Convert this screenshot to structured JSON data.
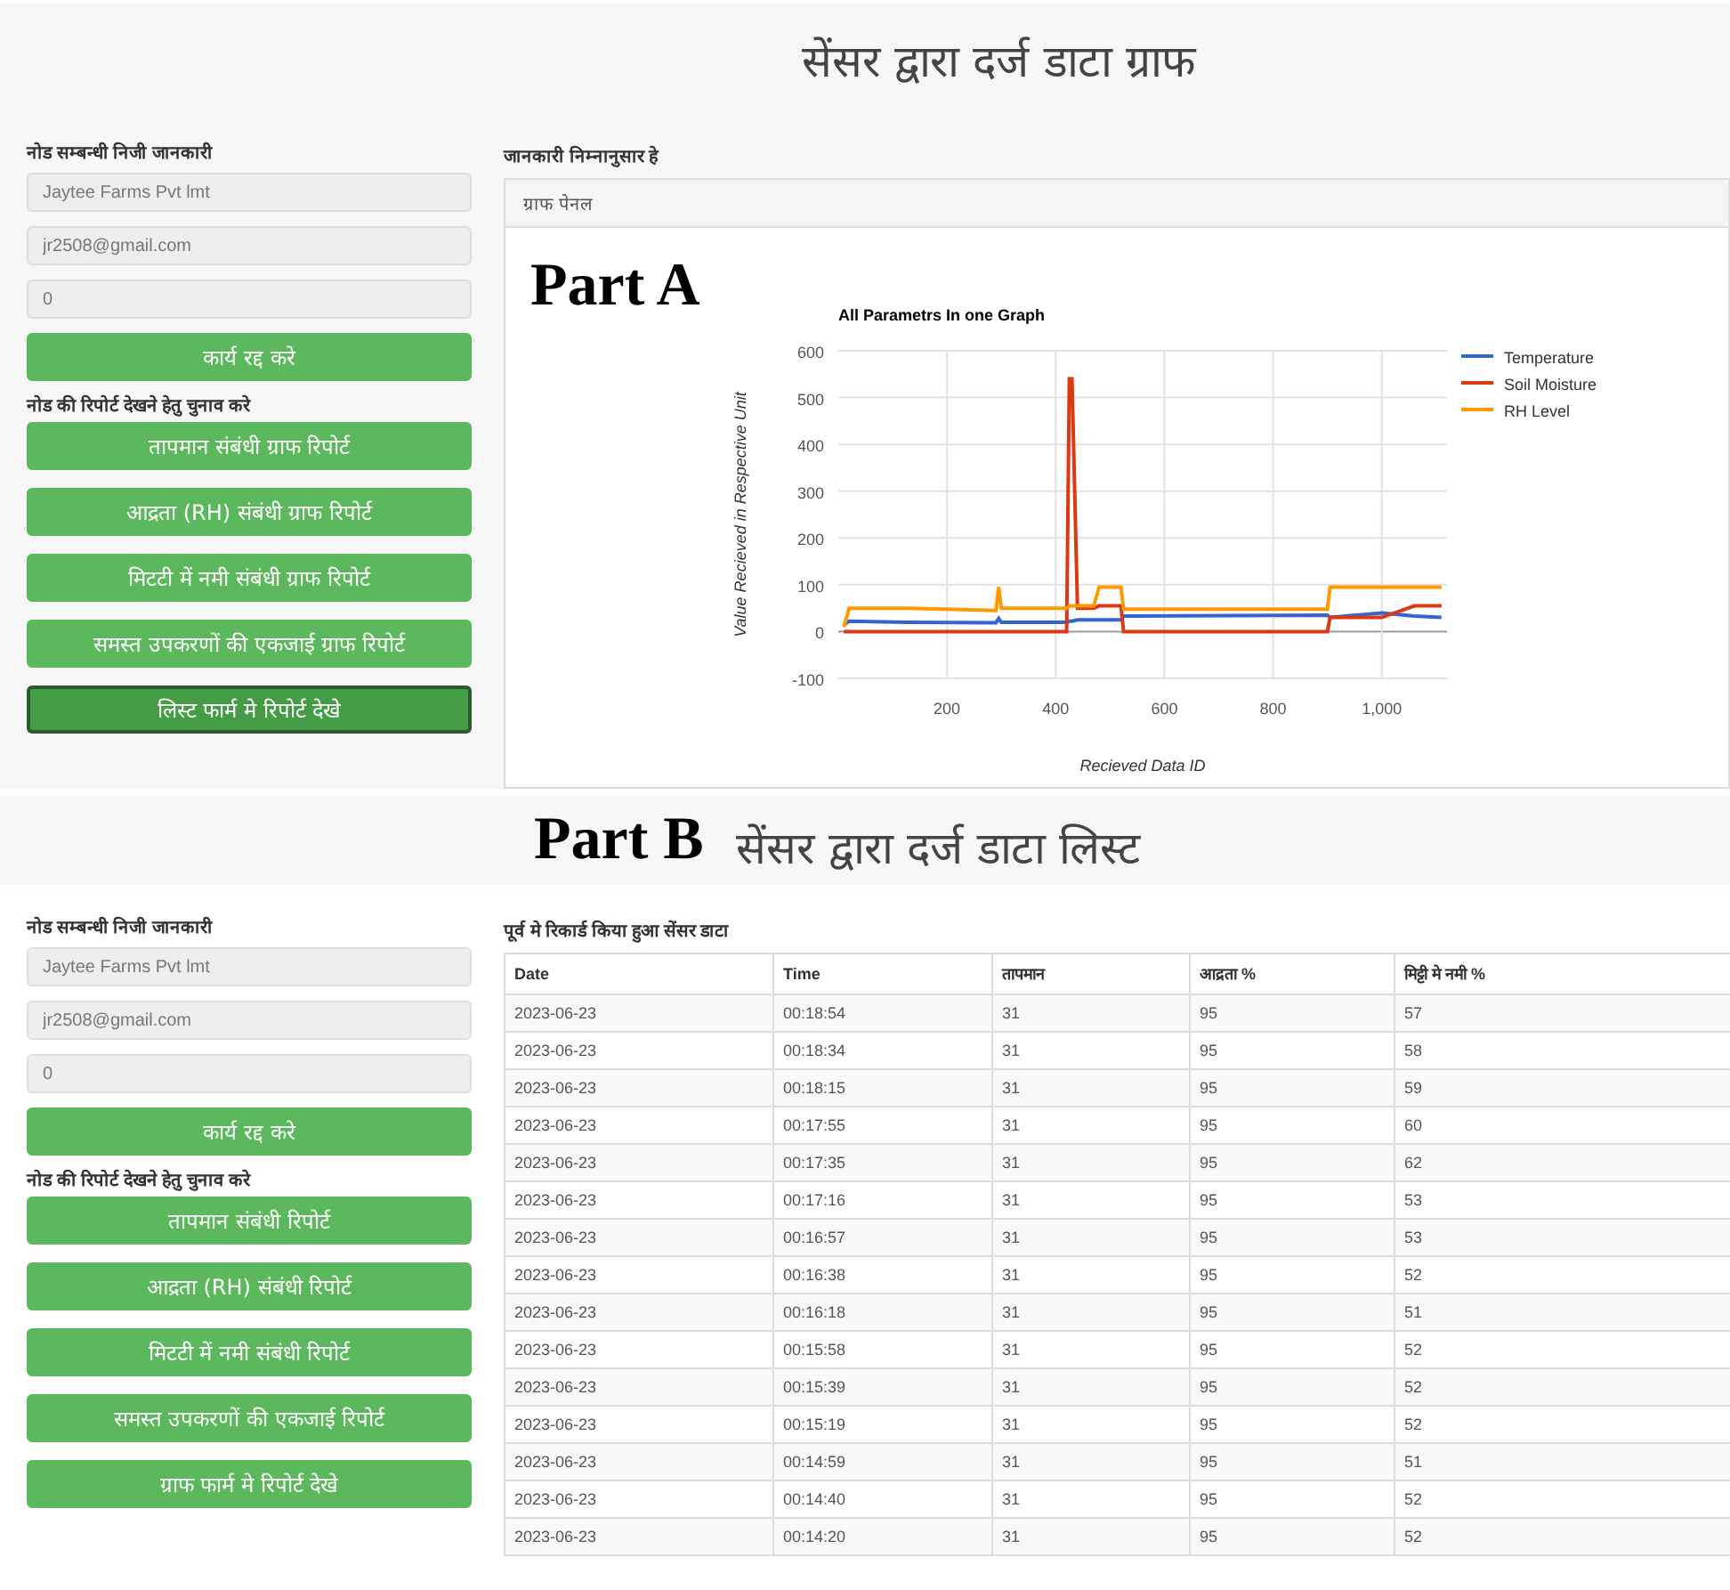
{
  "part_a": {
    "figure_label": "Part A",
    "page_title": "सेंसर द्वारा दर्ज डाटा ग्राफ",
    "sidebar": {
      "heading": "नोड सम्बन्धी निजी जानकारी",
      "fields": [
        "Jaytee Farms Pvt lmt",
        "jr2508@gmail.com",
        "0"
      ],
      "cancel_button": "कार्य रद्द करे",
      "reports_heading": "नोड की रिपोर्ट देखने हेतु चुनाव करे",
      "report_buttons": [
        {
          "label": "तापमान संबंधी ग्राफ रिपोर्ट",
          "selected": false
        },
        {
          "label": "आद्रता (RH) संबंधी ग्राफ रिपोर्ट",
          "selected": false
        },
        {
          "label": "मिटटी में नमी संबंधी ग्राफ रिपोर्ट",
          "selected": false
        },
        {
          "label": "समस्त उपकरणों की एकजाई ग्राफ रिपोर्ट",
          "selected": false
        },
        {
          "label": "लिस्ट फार्म मे रिपोर्ट देखे",
          "selected": true
        }
      ]
    },
    "panel": {
      "heading": "जानकारी निम्नानुसार हे",
      "header": "ग्राफ पेनल",
      "chart_data": {
        "type": "line",
        "title": "All Parametrs In one Graph",
        "xlabel": "Recieved Data ID",
        "ylabel": "Value Recieved in Respective Unit",
        "x": [
          10,
          20,
          130,
          290,
          295,
          300,
          420,
          425,
          430,
          440,
          470,
          480,
          520,
          525,
          900,
          905,
          1000,
          1060,
          1110
        ],
        "series": [
          {
            "name": "Temperature",
            "color": "#3366cc",
            "values": [
              15,
              22,
              20,
              19,
              28,
              20,
              20,
              22,
              22,
              25,
              25,
              25,
              25,
              33,
              35,
              30,
              40,
              33,
              30
            ]
          },
          {
            "name": "Soil Moisture",
            "color": "#dc3912",
            "values": [
              0,
              0,
              0,
              0,
              0,
              0,
              0,
              540,
              540,
              50,
              50,
              55,
              55,
              0,
              0,
              30,
              30,
              55,
              55
            ]
          },
          {
            "name": "RH Level",
            "color": "#ff9900",
            "values": [
              10,
              50,
              50,
              45,
              95,
              50,
              50,
              55,
              55,
              55,
              55,
              95,
              95,
              48,
              48,
              95,
              95,
              95,
              95
            ]
          }
        ],
        "xlim": [
          0,
          1120
        ],
        "ylim": [
          -100,
          600
        ],
        "xticks": [
          200,
          400,
          600,
          800,
          {
            "value": 1000,
            "label": "1,000"
          }
        ],
        "yticks": [
          -100,
          0,
          100,
          200,
          300,
          400,
          500,
          600
        ],
        "grid": true,
        "legend": "right"
      }
    }
  },
  "part_b": {
    "figure_label": "Part B",
    "page_title": "सेंसर द्वारा दर्ज डाटा लिस्ट",
    "sidebar": {
      "heading": "नोड सम्बन्धी निजी जानकारी",
      "fields": [
        "Jaytee Farms Pvt lmt",
        "jr2508@gmail.com",
        "0"
      ],
      "cancel_button": "कार्य रद्द करे",
      "reports_heading": "नोड की रिपोर्ट देखने हेतु चुनाव करे",
      "report_buttons": [
        {
          "label": "तापमान संबंधी रिपोर्ट",
          "selected": false
        },
        {
          "label": "आद्रता (RH) संबंधी रिपोर्ट",
          "selected": false
        },
        {
          "label": "मिटटी में नमी संबंधी रिपोर्ट",
          "selected": false
        },
        {
          "label": "समस्त उपकरणों की एकजाई रिपोर्ट",
          "selected": false
        },
        {
          "label": "ग्राफ फार्म मे रिपोर्ट देखे",
          "selected": false
        }
      ]
    },
    "table": {
      "heading": "पूर्व मे रिकार्ड किया हुआ सेंसर डाटा",
      "columns": [
        "Date",
        "Time",
        "तापमान",
        "आद्रता %",
        "मिट्टी मे नमी %"
      ],
      "rows": [
        [
          "2023-06-23",
          "00:18:54",
          "31",
          "95",
          "57"
        ],
        [
          "2023-06-23",
          "00:18:34",
          "31",
          "95",
          "58"
        ],
        [
          "2023-06-23",
          "00:18:15",
          "31",
          "95",
          "59"
        ],
        [
          "2023-06-23",
          "00:17:55",
          "31",
          "95",
          "60"
        ],
        [
          "2023-06-23",
          "00:17:35",
          "31",
          "95",
          "62"
        ],
        [
          "2023-06-23",
          "00:17:16",
          "31",
          "95",
          "53"
        ],
        [
          "2023-06-23",
          "00:16:57",
          "31",
          "95",
          "53"
        ],
        [
          "2023-06-23",
          "00:16:38",
          "31",
          "95",
          "52"
        ],
        [
          "2023-06-23",
          "00:16:18",
          "31",
          "95",
          "51"
        ],
        [
          "2023-06-23",
          "00:15:58",
          "31",
          "95",
          "52"
        ],
        [
          "2023-06-23",
          "00:15:39",
          "31",
          "95",
          "52"
        ],
        [
          "2023-06-23",
          "00:15:19",
          "31",
          "95",
          "52"
        ],
        [
          "2023-06-23",
          "00:14:59",
          "31",
          "95",
          "51"
        ],
        [
          "2023-06-23",
          "00:14:40",
          "31",
          "95",
          "52"
        ],
        [
          "2023-06-23",
          "00:14:20",
          "31",
          "95",
          "52"
        ]
      ]
    }
  }
}
